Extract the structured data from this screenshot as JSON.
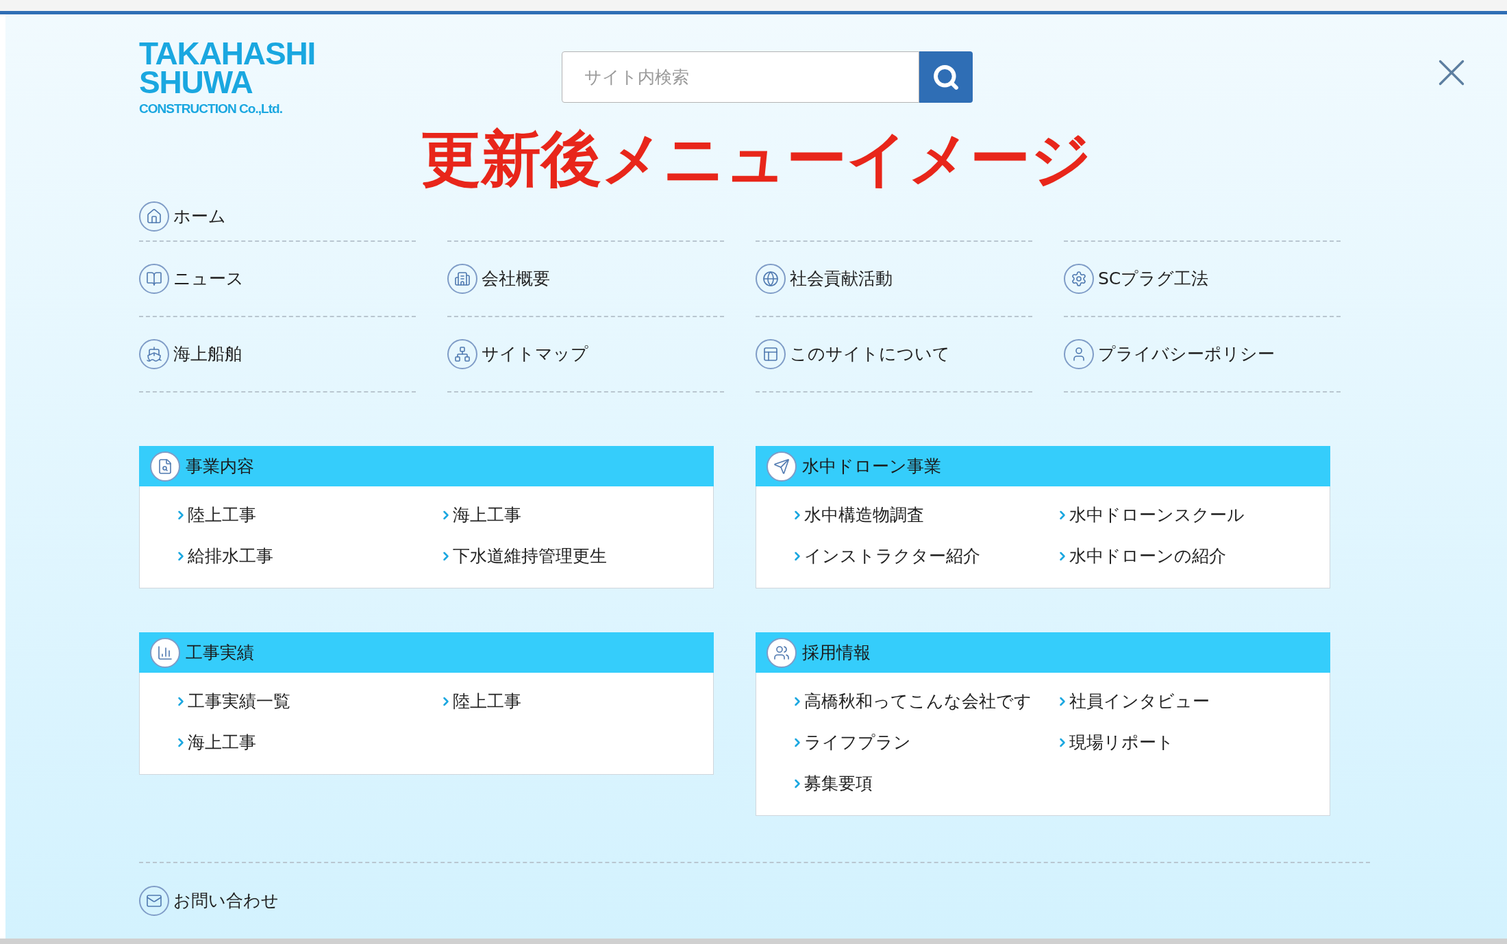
{
  "logo": {
    "lines": [
      "TAKAHASHI",
      "SHUWA",
      "CONSTRUCTION Co.,Ltd."
    ]
  },
  "search": {
    "placeholder": "サイト内検索"
  },
  "banner_title": "更新後メニューイメージ",
  "home": {
    "label": "ホーム"
  },
  "nav_items": [
    {
      "label": "ニュース"
    },
    {
      "label": "会社概要"
    },
    {
      "label": "社会貢献活動"
    },
    {
      "label": "SCプラグ工法"
    },
    {
      "label": "海上船舶"
    },
    {
      "label": "サイトマップ"
    },
    {
      "label": "このサイトについて"
    },
    {
      "label": "プライバシーポリシー"
    }
  ],
  "sections": [
    {
      "title": "事業内容",
      "links": [
        "陸上工事",
        "海上工事",
        "給排水工事",
        "下水道維持管理更生"
      ]
    },
    {
      "title": "水中ドローン事業",
      "links": [
        "水中構造物調査",
        "水中ドローンスクール",
        "インストラクター紹介",
        "水中ドローンの紹介"
      ]
    },
    {
      "title": "工事実績",
      "links": [
        "工事実績一覧",
        "陸上工事",
        "海上工事"
      ]
    },
    {
      "title": "採用情報",
      "links": [
        "高橋秋和ってこんな会社です",
        "社員インタビュー",
        "ライフプラン",
        "現場リポート",
        "募集要項"
      ]
    }
  ],
  "contact": {
    "label": "お問い合わせ"
  }
}
